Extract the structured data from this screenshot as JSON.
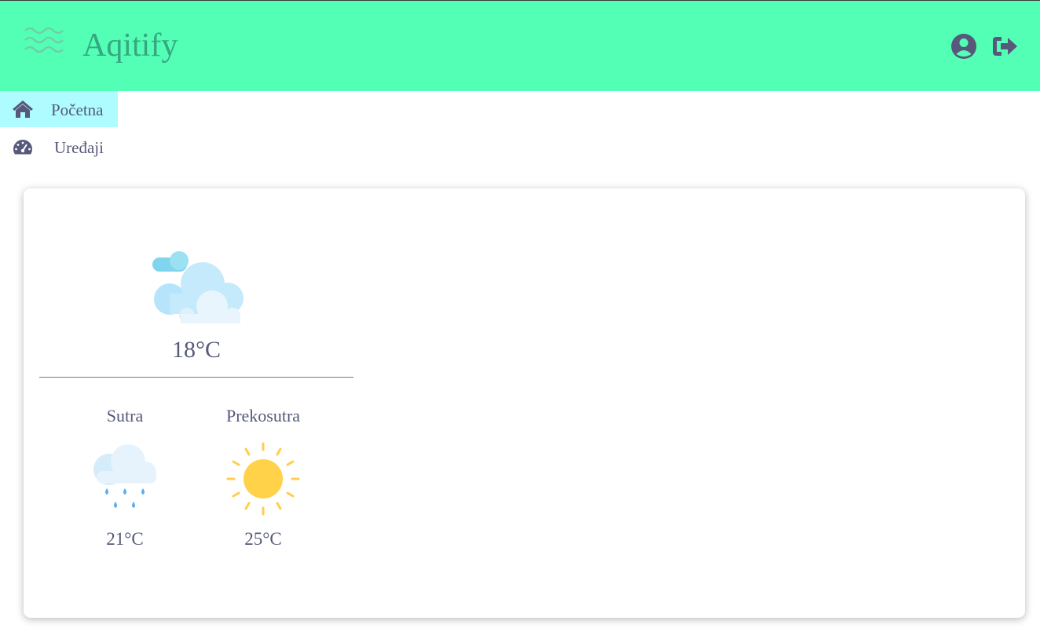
{
  "header": {
    "app_title": "Aqitify",
    "logo_icon": "waves-icon",
    "user_icon": "user-circle-icon",
    "logout_icon": "sign-out-icon",
    "background_color": "#53ffb5",
    "title_color": "#35a882"
  },
  "nav": {
    "items": [
      {
        "label": "Početna",
        "icon": "home-icon",
        "active": true
      },
      {
        "label": "Uređaji",
        "icon": "tachometer-icon",
        "active": false
      }
    ],
    "active_color": "#aefcff"
  },
  "weather": {
    "current": {
      "icon": "cloudy-icon",
      "temperature": "18°C"
    },
    "forecast": [
      {
        "day": "Sutra",
        "icon": "rain-cloud-icon",
        "temperature": "21°C"
      },
      {
        "day": "Prekosutra",
        "icon": "sun-icon",
        "temperature": "25°C"
      }
    ]
  }
}
